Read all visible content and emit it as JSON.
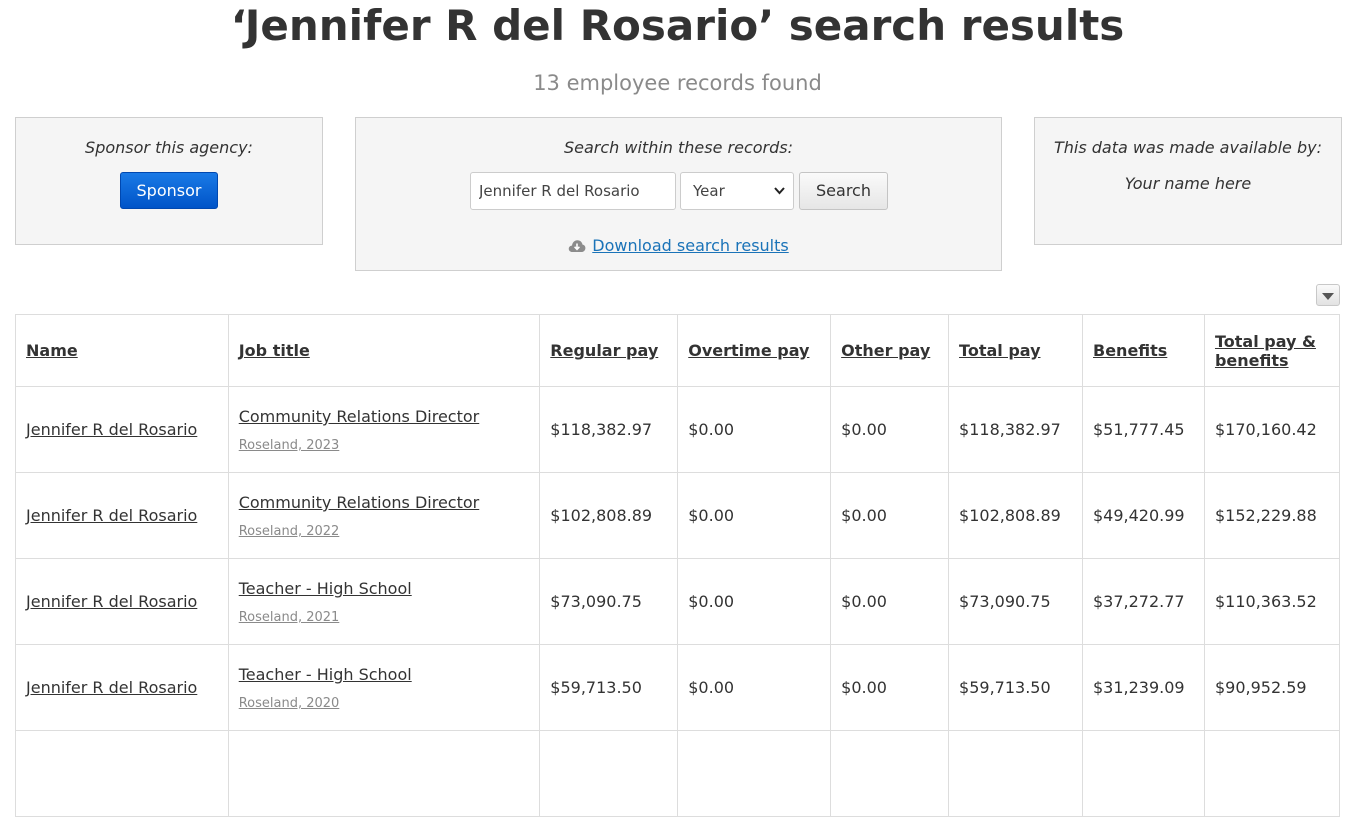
{
  "header": {
    "title": "‘Jennifer R del Rosario’ search results",
    "subtitle": "13 employee records found"
  },
  "sponsor_panel": {
    "label": "Sponsor this agency:",
    "button_label": "Sponsor"
  },
  "search_panel": {
    "label": "Search within these records:",
    "input_value": "Jennifer R del Rosario",
    "year_select": "Year",
    "button_label": "Search",
    "download_label": "Download search results"
  },
  "credit_panel": {
    "label": "This data was made available by:",
    "name": "Your name here"
  },
  "colors": {
    "sponsor_button": "#0066d6",
    "link": "#1a73b8"
  },
  "table": {
    "columns": [
      "Name",
      "Job title",
      "Regular pay",
      "Overtime pay",
      "Other pay",
      "Total pay",
      "Benefits",
      "Total pay & benefits"
    ],
    "rows": [
      {
        "name": "Jennifer R del Rosario",
        "job_title": "Community Relations Director",
        "job_sub": "Roseland, 2023",
        "regular": "$118,382.97",
        "overtime": "$0.00",
        "other": "$0.00",
        "total": "$118,382.97",
        "benefits": "$51,777.45",
        "total_benefits": "$170,160.42"
      },
      {
        "name": "Jennifer R del Rosario",
        "job_title": "Community Relations Director",
        "job_sub": "Roseland, 2022",
        "regular": "$102,808.89",
        "overtime": "$0.00",
        "other": "$0.00",
        "total": "$102,808.89",
        "benefits": "$49,420.99",
        "total_benefits": "$152,229.88"
      },
      {
        "name": "Jennifer R del Rosario",
        "job_title": "Teacher - High School",
        "job_sub": "Roseland, 2021",
        "regular": "$73,090.75",
        "overtime": "$0.00",
        "other": "$0.00",
        "total": "$73,090.75",
        "benefits": "$37,272.77",
        "total_benefits": "$110,363.52"
      },
      {
        "name": "Jennifer R del Rosario",
        "job_title": "Teacher - High School",
        "job_sub": "Roseland, 2020",
        "regular": "$59,713.50",
        "overtime": "$0.00",
        "other": "$0.00",
        "total": "$59,713.50",
        "benefits": "$31,239.09",
        "total_benefits": "$90,952.59"
      }
    ]
  }
}
